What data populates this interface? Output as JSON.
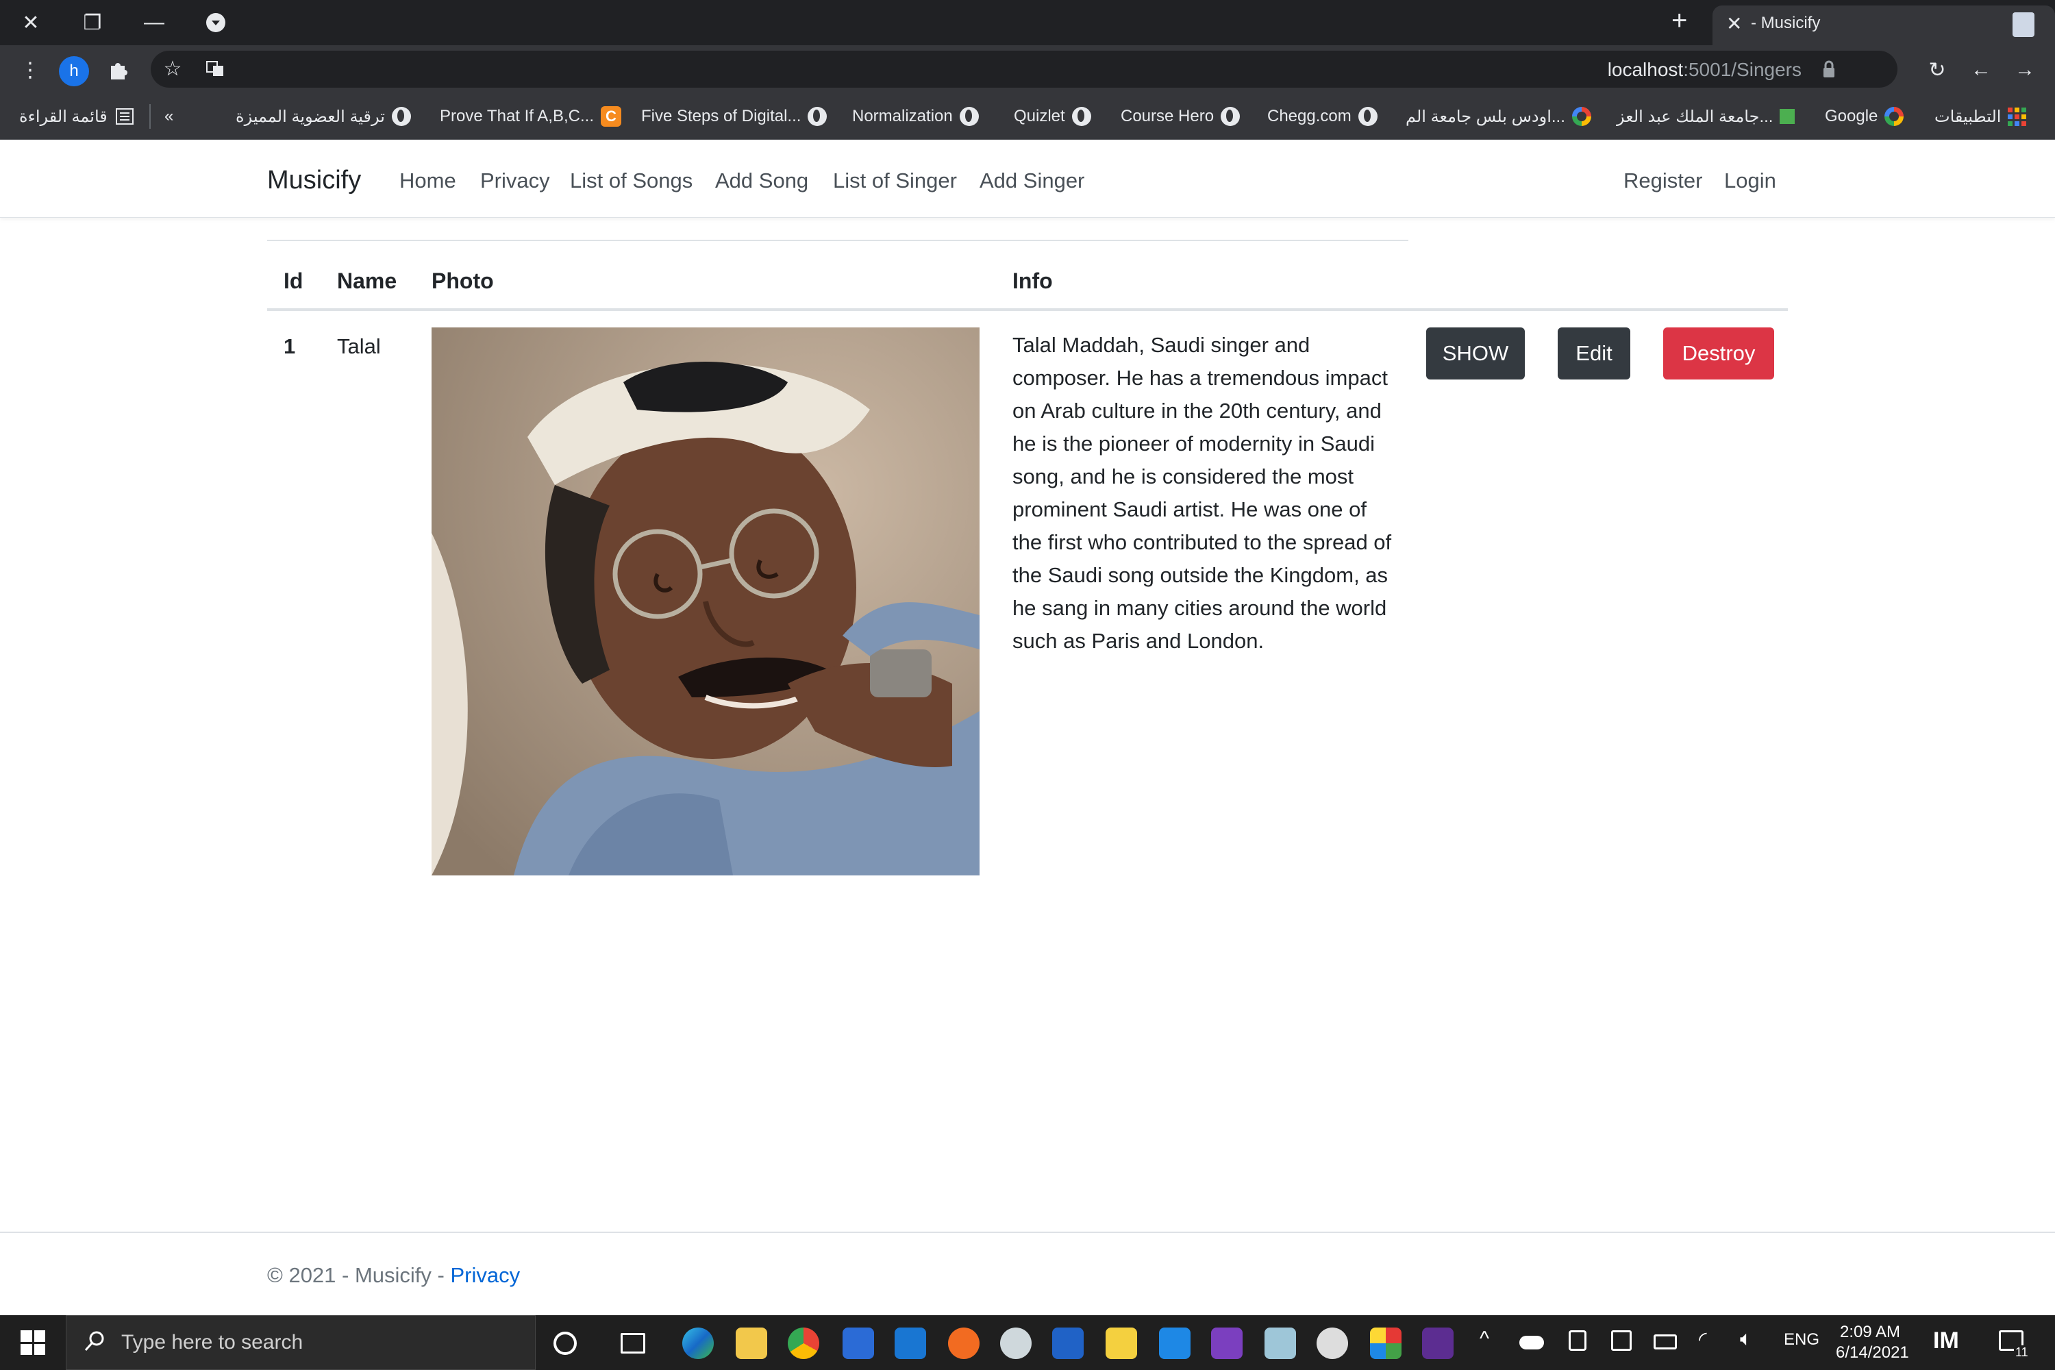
{
  "browser": {
    "tab_title": "- Musicify",
    "url_host": "localhost",
    "url_rest": ":5001/Singers",
    "profile_initial": "h",
    "bookmarks": [
      {
        "label": "التطبيقات",
        "icon": "apps-icon"
      },
      {
        "label": "Google",
        "icon": "google-icon"
      },
      {
        "label": "جامعة الملك عبد العز...",
        "icon": "university-icon"
      },
      {
        "label": "اودس بلس جامعة الم...",
        "icon": "google-icon"
      },
      {
        "label": "Chegg.com",
        "icon": "globe-icon"
      },
      {
        "label": "Course Hero",
        "icon": "globe-icon"
      },
      {
        "label": "Quizlet",
        "icon": "globe-icon"
      },
      {
        "label": "Normalization",
        "icon": "globe-icon"
      },
      {
        "label": "Five Steps of Digital...",
        "icon": "globe-icon"
      },
      {
        "label": "Prove That If A,B,C...",
        "icon": "chegg-icon"
      },
      {
        "label": "ترقية العضوية المميزة",
        "icon": "globe-icon"
      }
    ],
    "more_bookmarks": "«",
    "reading_list": "قائمة القراءة"
  },
  "site": {
    "brand": "Musicify",
    "nav": [
      "Home",
      "Privacy",
      "List of Songs",
      "Add Song",
      "List of Singer",
      "Add Singer"
    ],
    "auth": [
      "Register",
      "Login"
    ]
  },
  "table": {
    "headers": {
      "id": "Id",
      "name": "Name",
      "photo": "Photo",
      "info": "Info"
    },
    "rows": [
      {
        "id": "1",
        "name": "Talal",
        "info": "Talal Maddah, Saudi singer and composer. He has a tremendous impact on Arab culture in the 20th century, and he is the pioneer of modernity in Saudi song, and he is considered the most prominent Saudi artist. He was one of the first who contributed to the spread of the Saudi song outside the Kingdom, as he sang in many cities around the world such as Paris and London.",
        "actions": {
          "show": "SHOW",
          "edit": "Edit",
          "destroy": "Destroy"
        }
      }
    ]
  },
  "footer": {
    "text": "© 2021 - Musicify - ",
    "link": "Privacy"
  },
  "taskbar": {
    "search_placeholder": "Type here to search",
    "language": "ENG",
    "time": "2:09 AM",
    "date": "6/14/2021",
    "notification_count": "11"
  },
  "colors": {
    "danger": "#dc3545",
    "dark": "#343a40",
    "link": "#0366d6",
    "chrome_dark": "#202124"
  }
}
